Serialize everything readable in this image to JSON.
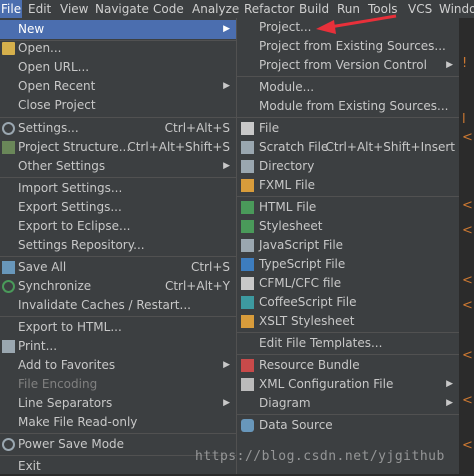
{
  "menubar": {
    "items": [
      "File",
      "Edit",
      "View",
      "Navigate",
      "Code",
      "Analyze",
      "Refactor",
      "Build",
      "Run",
      "Tools",
      "VCS",
      "Windo"
    ]
  },
  "file_menu": {
    "items": [
      {
        "label": "New",
        "shortcut": "",
        "submenu": true,
        "selected": true,
        "icon": ""
      },
      {
        "label": "Open...",
        "shortcut": "",
        "icon": "folder-open-icon"
      },
      {
        "label": "Open URL...",
        "shortcut": ""
      },
      {
        "label": "Open Recent",
        "shortcut": "",
        "submenu": true
      },
      {
        "label": "Close Project",
        "shortcut": ""
      },
      {
        "label": "Settings...",
        "shortcut": "Ctrl+Alt+S",
        "icon": "gear-icon"
      },
      {
        "label": "Project Structure...",
        "shortcut": "Ctrl+Alt+Shift+S",
        "icon": "project-structure-icon"
      },
      {
        "label": "Other Settings",
        "shortcut": "",
        "submenu": true
      },
      {
        "label": "Import Settings...",
        "shortcut": ""
      },
      {
        "label": "Export Settings...",
        "shortcut": ""
      },
      {
        "label": "Export to Eclipse...",
        "shortcut": ""
      },
      {
        "label": "Settings Repository...",
        "shortcut": ""
      },
      {
        "label": "Save All",
        "shortcut": "Ctrl+S",
        "icon": "save-icon"
      },
      {
        "label": "Synchronize",
        "shortcut": "Ctrl+Alt+Y",
        "icon": "sync-icon"
      },
      {
        "label": "Invalidate Caches / Restart...",
        "shortcut": ""
      },
      {
        "label": "Export to HTML...",
        "shortcut": ""
      },
      {
        "label": "Print...",
        "shortcut": "",
        "icon": "print-icon"
      },
      {
        "label": "Add to Favorites",
        "shortcut": "",
        "submenu": true
      },
      {
        "label": "File Encoding",
        "shortcut": "",
        "disabled": true
      },
      {
        "label": "Line Separators",
        "shortcut": "",
        "submenu": true
      },
      {
        "label": "Make File Read-only",
        "shortcut": ""
      },
      {
        "label": "Power Save Mode",
        "shortcut": "",
        "icon": "power-icon"
      },
      {
        "label": "Exit",
        "shortcut": ""
      }
    ]
  },
  "new_submenu": {
    "items": [
      {
        "label": "Project...",
        "shortcut": ""
      },
      {
        "label": "Project from Existing Sources...",
        "shortcut": ""
      },
      {
        "label": "Project from Version Control",
        "shortcut": "",
        "submenu": true
      },
      {
        "label": "Module...",
        "shortcut": ""
      },
      {
        "label": "Module from Existing Sources...",
        "shortcut": ""
      },
      {
        "label": "File",
        "shortcut": "",
        "icon": "file-icon"
      },
      {
        "label": "Scratch File",
        "shortcut": "Ctrl+Alt+Shift+Insert",
        "icon": "scratch-file-icon"
      },
      {
        "label": "Directory",
        "shortcut": "",
        "icon": "directory-icon"
      },
      {
        "label": "FXML File",
        "shortcut": "",
        "icon": "fxml-file-icon"
      },
      {
        "label": "HTML File",
        "shortcut": "",
        "icon": "html-file-icon"
      },
      {
        "label": "Stylesheet",
        "shortcut": "",
        "icon": "stylesheet-icon"
      },
      {
        "label": "JavaScript File",
        "shortcut": "",
        "icon": "javascript-file-icon"
      },
      {
        "label": "TypeScript File",
        "shortcut": "",
        "icon": "typescript-file-icon"
      },
      {
        "label": "CFML/CFC file",
        "shortcut": "",
        "icon": "cfml-file-icon"
      },
      {
        "label": "CoffeeScript File",
        "shortcut": "",
        "icon": "coffeescript-file-icon"
      },
      {
        "label": "XSLT Stylesheet",
        "shortcut": "",
        "icon": "xslt-stylesheet-icon"
      },
      {
        "label": "Edit File Templates...",
        "shortcut": ""
      },
      {
        "label": "Resource Bundle",
        "shortcut": "",
        "icon": "resource-bundle-icon"
      },
      {
        "label": "XML Configuration File",
        "shortcut": "",
        "submenu": true,
        "icon": "xml-config-icon"
      },
      {
        "label": "Diagram",
        "shortcut": "",
        "submenu": true
      },
      {
        "label": "Data Source",
        "shortcut": "",
        "icon": "data-source-icon"
      }
    ]
  },
  "watermark": "https://blog.csdn.net/yjgithub",
  "colors": {
    "menu_bg": "#3c3f41",
    "selection": "#4b6eaf",
    "annotation_arrow": "#e8303a"
  }
}
